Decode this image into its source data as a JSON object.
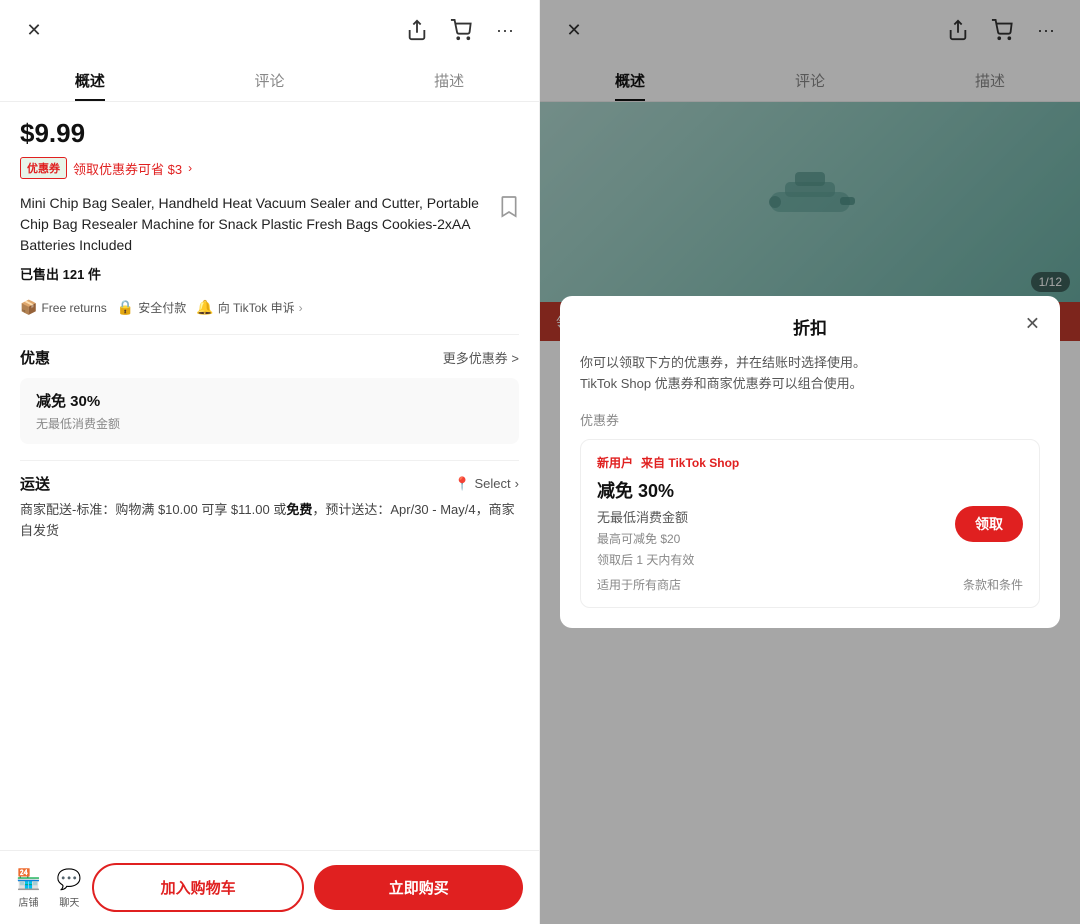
{
  "left": {
    "nav": {
      "close_icon": "✕",
      "share_icon": "⎋",
      "cart_icon": "🛒",
      "more_icon": "···"
    },
    "tabs": [
      {
        "id": "overview",
        "label": "概述",
        "active": true
      },
      {
        "id": "reviews",
        "label": "评论",
        "active": false
      },
      {
        "id": "description",
        "label": "描述",
        "active": false
      }
    ],
    "price": "$9.99",
    "coupon_tag": {
      "label": "优惠券",
      "text": "领取优惠券可省 $3",
      "arrow": "∨"
    },
    "product_title": "Mini Chip Bag Sealer, Handheld Heat Vacuum Sealer and Cutter, Portable Chip Bag Resealer Machine for Snack Plastic Fresh Bags Cookies-2xAA Batteries Included",
    "sold_prefix": "已售出",
    "sold_count": "121",
    "sold_suffix": "件",
    "badges": [
      {
        "icon": "🟡",
        "text": "Free returns"
      },
      {
        "icon": "🟦",
        "text": "安全付款"
      },
      {
        "icon": "🔶",
        "text": "向 TikTok 申诉"
      }
    ],
    "discount_section": {
      "title": "优惠",
      "more_link": "更多优惠券 >",
      "card": {
        "title": "减免 30%",
        "subtitle": "无最低消费金额"
      }
    },
    "shipping_section": {
      "title": "运送",
      "select_icon": "📍",
      "select_text": "Select",
      "select_arrow": ">",
      "details": "商家配送-标准：购物满 $10.00 可享 $11.00 或免费，预计送达：Apr/30 - May/4，商家自发货"
    },
    "bottom_bar": {
      "store_icon": "🏪",
      "store_label": "店铺",
      "chat_icon": "💬",
      "chat_label": "聊天",
      "add_to_cart": "加入购物车",
      "buy_now": "立即购买"
    }
  },
  "right": {
    "nav": {
      "close_icon": "✕",
      "share_icon": "⎋",
      "cart_icon": "🛒",
      "more_icon": "···"
    },
    "tabs": [
      {
        "id": "overview",
        "label": "概述",
        "active": true
      },
      {
        "id": "reviews",
        "label": "评论",
        "active": false
      },
      {
        "id": "description",
        "label": "描述",
        "active": false
      }
    ],
    "image_counter": "1/12",
    "red_banner_text": "领取下方优惠券",
    "modal": {
      "title": "折扣",
      "close_icon": "✕",
      "description": "你可以领取下方的优惠券，并在结账时选择使用。\nTikTok Shop 优惠券和商家优惠券可以组合使用。",
      "section_label": "优惠券",
      "coupon": {
        "tag_new": "新用户",
        "tag_from": "来自 TikTok Shop",
        "title": "减免 30%",
        "subtitle": "无最低消费金额",
        "max_discount": "最高可减免 $20",
        "validity": "领取后 1 天内有效",
        "scope": "适用于所有商店",
        "terms": "条款和条件",
        "claim_btn": "领取"
      }
    }
  }
}
